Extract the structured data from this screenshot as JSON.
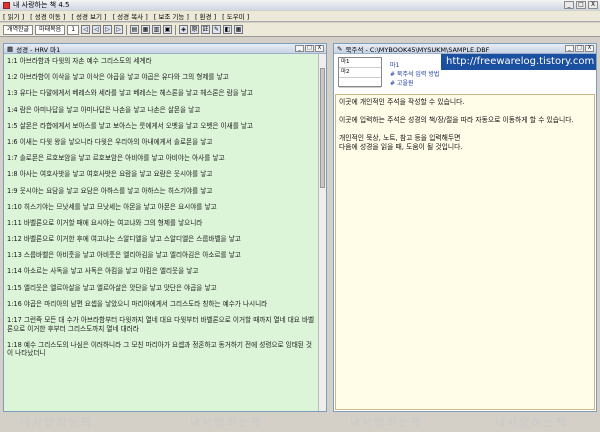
{
  "window": {
    "title": "내 사랑하는 책 4.5",
    "buttons": [
      "_",
      "□",
      "X"
    ]
  },
  "menu": [
    "[ 읽기 ]",
    "[ 성경 이동 ]",
    "[ 성경 보기 ]",
    "[ 성경 복사 ]",
    "[ 보조 기능 ]",
    "[ 환경 ]",
    "[ 도우미 ]"
  ],
  "toolbar": {
    "book_button": "개역한글",
    "version_button": "마태복음",
    "chapter_value": "1",
    "icons": [
      "◁",
      "◁",
      "▷",
      "▷",
      "▤",
      "▦",
      "▥",
      "▣",
      "◈",
      "原",
      "註",
      "✎",
      "◧",
      "▦"
    ]
  },
  "left_pane": {
    "title": "성경 - HRV 마1",
    "buttons": [
      "_",
      "□",
      "X"
    ],
    "verses": [
      "1:1 아브라함과 다윗의 자손 예수 그리스도의 세계라",
      "1:2 아브라함이 이삭을 낳고 이삭은 야곱을 낳고 야곱은 유다와 그의 형제를 낳고",
      "1:3 유다는 다말에게서 베레스와 세라를 낳고 베레스는 헤스론을 낳고 헤스론은 람을 낳고",
      "1:4 람은 아미나답을 낳고 아미나답은 나손을 낳고 나손은 살몬을 낳고",
      "1:5 살몬은 라합에게서 보아스를 낳고 보아스는 룻에게서 오벳을 낳고 오벳은 이새를 낳고",
      "1:6 이새는 다윗 왕을 낳으니라 다윗은 우리아의 아내에게서 솔로몬을 낳고",
      "1:7 솔로몬은 르호보암을 낳고 르호보암은 아비야를 낳고 아비야는 아사를 낳고",
      "1:8 아사는 여호사밧을 낳고 여호사밧은 요람을 낳고 요람은 웃시야를 낳고",
      "1:9 웃시야는 요담을 낳고 요담은 아하스를 낳고 아하스는 히스기야를 낳고",
      "1:10 히스기야는 므낫세를 낳고 므낫세는 아몬을 낳고 아몬은 요시야를 낳고",
      "1:11 바벨론으로 이거할 때에 요시야는 여고냐와 그의 형제를 낳으니라",
      "1:12 바벨론으로 이거한 후에 여고냐는 스알디엘을 낳고 스알디엘은 스룹바벨을 낳고",
      "1:13 스룹바벨은 아비훗을 낳고 아비훗은 엘리아김을 낳고 엘리아김은 아소르를 낳고",
      "1:14 아소르는 사독을 낳고 사독은 아킴을 낳고 아킴은 엘리웃을 낳고",
      "1:15 엘리웃은 엘르아살을 낳고 엘르아살은 맛단을 낳고 맛단은 야곱을 낳고",
      "1:16 야곱은 마리아의 남편 요셉을 낳았으니 마리아에게서 그리스도라 칭하는 예수가 나시니라",
      "1:17 그런즉 모든 대 수가 아브라함부터 다윗까지 열네 대요 다윗부터 바벨론으로 이거할 때까지 열네 대요 바벨론으로 이거한 후부터 그리스도까지 열네 대러라",
      "1:18 예수 그리스도의 나심은 이러하니라 그 모친 마리아가 요셉과 정혼하고 동거하기 전에 성령으로 잉태된 것이 나타났더니"
    ]
  },
  "right_pane": {
    "title": "묵주석 - C:\\MYBOOK45\\MYSUKM\\SAMPLE.DBF",
    "buttons": [
      "_",
      "□",
      "X"
    ],
    "grid_rows": [
      "마1",
      "마2",
      ""
    ],
    "links": [
      "마1",
      "# 묵주석 입력 방법",
      "# 고을원"
    ],
    "body": [
      "이곳에 개인적인 주석을 작성할 수 있습니다.",
      "이곳에 입력하는 주석은 성경의 책/장/절을 따라 자동으로 이동하게 할 수 있습니다.",
      "개인적인 묵상, 노트, 참고 등을 입력해두면",
      "다음에 성경을 읽을 때, 도움이 될 것입니다."
    ]
  },
  "overlay": {
    "url": "http://freewarelog.tistory.com"
  },
  "watermarks": [
    "내사랑하는책",
    "내사랑하는책",
    "내사랑하는책",
    "내사랑하는책"
  ]
}
